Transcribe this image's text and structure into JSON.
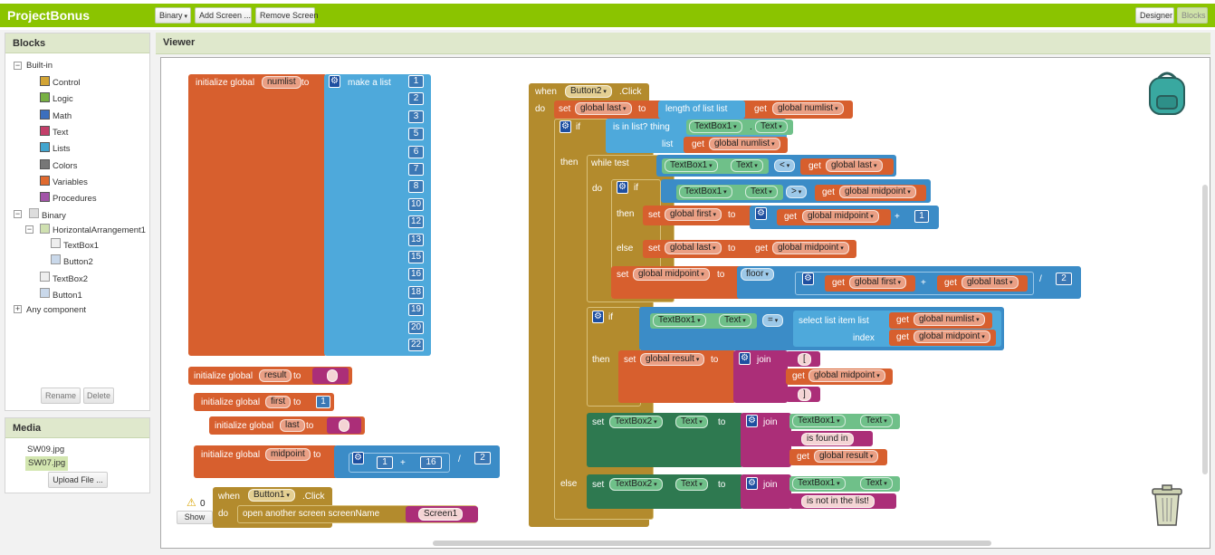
{
  "app": {
    "title": "ProjectBonus",
    "screen_select": "Binary",
    "add_screen": "Add Screen ...",
    "remove_screen": "Remove Screen",
    "designer": "Designer",
    "blocks": "Blocks"
  },
  "blocks_panel": {
    "title": "Blocks",
    "builtin": "Built-in",
    "items": [
      "Control",
      "Logic",
      "Math",
      "Text",
      "Lists",
      "Colors",
      "Variables",
      "Procedures"
    ],
    "colors": [
      "#d2a435",
      "#77b043",
      "#3c6fbd",
      "#c33f6a",
      "#42a5cf",
      "#777777",
      "#e06a2f",
      "#a254a8"
    ],
    "screen": "Binary",
    "arrangement": "HorizontalArrangement1",
    "tb1": "TextBox1",
    "btn2": "Button2",
    "tb2": "TextBox2",
    "btn1": "Button1",
    "any": "Any component",
    "rename": "Rename",
    "delete": "Delete"
  },
  "media": {
    "title": "Media",
    "files": [
      "SW09.jpg",
      "SW07.jpg"
    ],
    "upload": "Upload File ..."
  },
  "viewer": {
    "title": "Viewer",
    "warn_count": "0",
    "show": "Show"
  },
  "code": {
    "init_numlist": "initialize global",
    "numlist": "numlist",
    "to": "to",
    "make_list": "make a list",
    "numbers": [
      "1",
      "2",
      "3",
      "5",
      "6",
      "7",
      "8",
      "10",
      "12",
      "13",
      "15",
      "16",
      "18",
      "19",
      "20",
      "22"
    ],
    "init": "initialize global",
    "result": "result",
    "first": "first",
    "last": "last",
    "midpoint": "midpoint",
    "one": "1",
    "sixteen": "16",
    "two": "2",
    "quote": "\"",
    "when": "when",
    "do": "do",
    "button1": "Button1",
    "click": ".Click",
    "open_screen": "open another screen  screenName",
    "screen1": "Screen1",
    "button2": "Button2",
    "set": "set",
    "global_last": "global last",
    "length_of_list": "length of list  list",
    "get": "get",
    "global_numlist": "global numlist",
    "if": "if",
    "is_in_list": "is in list? thing",
    "textbox1": "TextBox1",
    "dot": ".",
    "text": "Text",
    "list": "list",
    "then": "then",
    "while_test": "while  test",
    "lt": "<",
    "gt": ">",
    "global_midpoint": "global midpoint",
    "global_first": "global first",
    "plus": "+",
    "else": "else",
    "floor": "floor",
    "div": "/",
    "eq": "=",
    "select_list_item": "select list item  list",
    "index": "index",
    "global_result": "global result",
    "join": "join",
    "lbracket": "[",
    "rbracket": "]",
    "textbox2": "TextBox2",
    "is_found_in": " is found in ",
    "not_in_list": " is not in the list! "
  }
}
